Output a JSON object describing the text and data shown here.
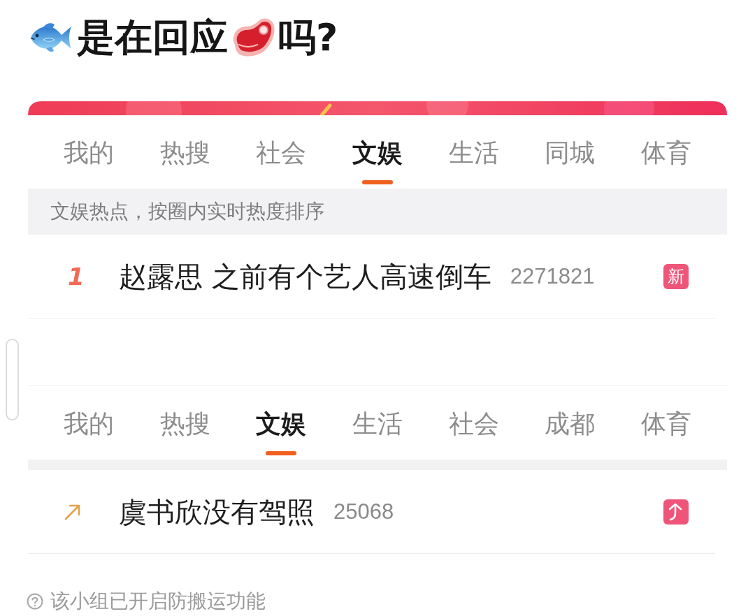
{
  "title": {
    "start": "是在回应",
    "end": "吗?"
  },
  "panels": [
    {
      "tabs": [
        {
          "label": "我的",
          "selected": false
        },
        {
          "label": "热搜",
          "selected": false
        },
        {
          "label": "社会",
          "selected": false
        },
        {
          "label": "文娱",
          "selected": true
        },
        {
          "label": "生活",
          "selected": false
        },
        {
          "label": "同城",
          "selected": false
        },
        {
          "label": "体育",
          "selected": false
        }
      ],
      "notice": "文娱热点，按圈内实时热度排序",
      "items": [
        {
          "kind": "ranked",
          "rank": "1",
          "title": "赵露思 之前有个艺人高速倒车",
          "count": "2271821",
          "badge": {
            "kind": "text",
            "text": "新"
          }
        }
      ]
    },
    {
      "tabs": [
        {
          "label": "我的",
          "selected": false
        },
        {
          "label": "热搜",
          "selected": false
        },
        {
          "label": "文娱",
          "selected": true
        },
        {
          "label": "生活",
          "selected": false
        },
        {
          "label": "社会",
          "selected": false
        },
        {
          "label": "成都",
          "selected": false
        },
        {
          "label": "体育",
          "selected": false
        }
      ],
      "items": [
        {
          "kind": "trend",
          "title": "虞书欣没有驾照",
          "count": "25068",
          "badge": {
            "kind": "rising"
          }
        }
      ]
    }
  ],
  "footer": {
    "text": "该小组已开启防搬运功能"
  }
}
